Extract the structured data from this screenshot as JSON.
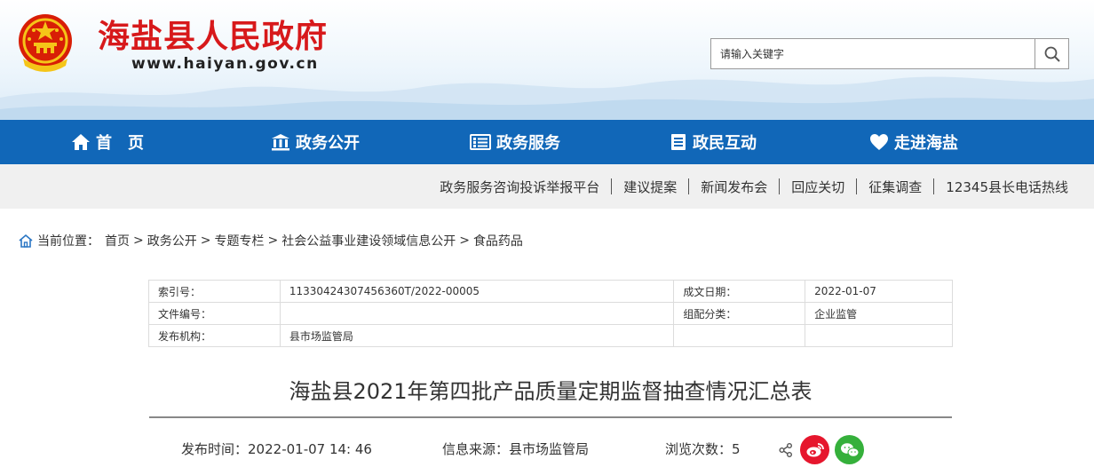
{
  "header": {
    "site_title": "海盐县人民政府",
    "site_url": "www.haiyan.gov.cn",
    "search_placeholder": "请输入关键字"
  },
  "nav": [
    {
      "label": "首　页",
      "icon": "home-icon"
    },
    {
      "label": "政务公开",
      "icon": "building-icon"
    },
    {
      "label": "政务服务",
      "icon": "list-icon"
    },
    {
      "label": "政民互动",
      "icon": "document-icon"
    },
    {
      "label": "走进海盐",
      "icon": "heart-icon"
    }
  ],
  "subnav": [
    "政务服务咨询投诉举报平台",
    "建议提案",
    "新闻发布会",
    "回应关切",
    "征集调查",
    "12345县长电话热线"
  ],
  "breadcrumb": {
    "prefix": "当前位置：",
    "items": [
      "首页",
      "政务公开",
      "专题专栏",
      "社会公益事业建设领域信息公开",
      "食品药品"
    ],
    "separator": ">"
  },
  "info": {
    "index_label": "索引号：",
    "index_value": "11330424307456360T/2022-00005",
    "date_label": "成文日期：",
    "date_value": "2022-01-07",
    "doc_label": "文件编号：",
    "doc_value": "",
    "category_label": "组配分类：",
    "category_value": "企业监管",
    "agency_label": "发布机构：",
    "agency_value": "县市场监管局"
  },
  "article": {
    "title": "海盐县2021年第四批产品质量定期监督抽查情况汇总表",
    "publish_label": "发布时间：",
    "publish_value": "2022-01-07 14: 46",
    "source_label": "信息来源：",
    "source_value": "县市场监管局",
    "views_label": "浏览次数：",
    "views_value": "5"
  },
  "colors": {
    "brand_red": "#d7191b",
    "nav_blue": "#1167b8",
    "subnav_bg": "#f0f0f0",
    "weibo_red": "#e6162d",
    "wechat_green": "#35b03b"
  }
}
